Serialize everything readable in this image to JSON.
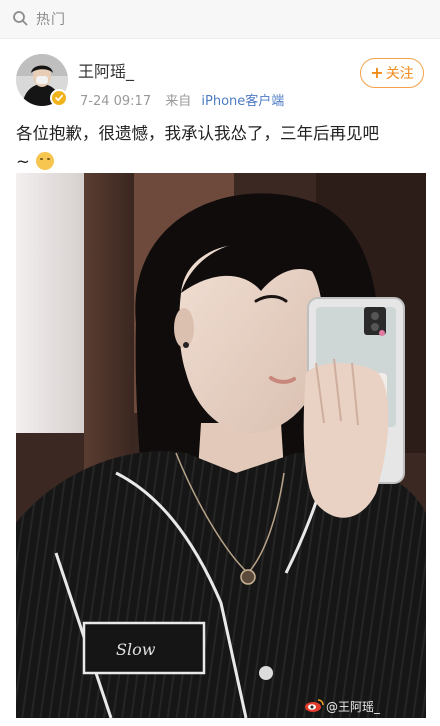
{
  "hot_bar": {
    "icon": "hot-search-icon",
    "label": "热门"
  },
  "post": {
    "user_name": "王阿瑶_",
    "verified": true,
    "time": "7-24 09:17",
    "source_prefix": "来自",
    "source": "iPhone客户端",
    "follow_label": "关注",
    "text_line1": "各位抱歉，很遗憾，我承认我怂了，三年后再见吧",
    "text_line2": "~",
    "emoji": "smile-emoji"
  },
  "photo": {
    "watermark": "@王阿瑶_",
    "watermark_icon": "weibo-logo"
  },
  "colors": {
    "accent_orange": "#f08b1c",
    "link_blue": "#4d7bc4",
    "verified_gold": "#f1b31c"
  }
}
